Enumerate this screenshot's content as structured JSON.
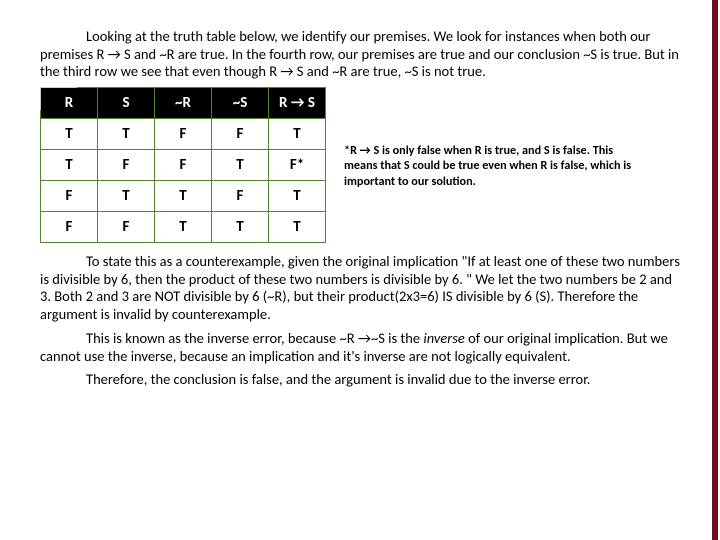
{
  "paragraphs": {
    "p1": "Looking at the truth table below, we identify our premises. We look for instances when both our premises R → S and ~R are true. In the fourth row, our premises are true and our conclusion ~S is true. But in the third row we see that even though R → S and ~R are true, ~S is not true.",
    "p2": "To state this as a counterexample, given the original implication \"If at least one of these two numbers is divisible by 6, then the product of these two numbers is divisible by 6. \" We let the two numbers be 2 and 3. Both 2 and 3 are NOT divisible by 6 (~R), but their product(2x3=6) IS divisible by 6 (S). Therefore the argument is invalid by counterexample.",
    "p3a": "This is known as the inverse error, because ~R →~S is the ",
    "p3b": "inverse",
    "p3c": " of our original implication. But we cannot use the inverse, because an implication and it's inverse are not logically equivalent.",
    "p4": "Therefore, the conclusion is false, and the argument is invalid due to the inverse error."
  },
  "side_note": "*R → S is only false when R is true, and S is false. This means that S could be true even when R is false, which is important to our solution.",
  "chart_data": {
    "type": "table",
    "headers": [
      "R",
      "S",
      "~R",
      "~S",
      "R → S"
    ],
    "rows": [
      [
        "T",
        "T",
        "F",
        "F",
        "T"
      ],
      [
        "T",
        "F",
        "F",
        "T",
        "F*"
      ],
      [
        "F",
        "T",
        "T",
        "F",
        "T"
      ],
      [
        "F",
        "F",
        "T",
        "T",
        "T"
      ]
    ]
  }
}
